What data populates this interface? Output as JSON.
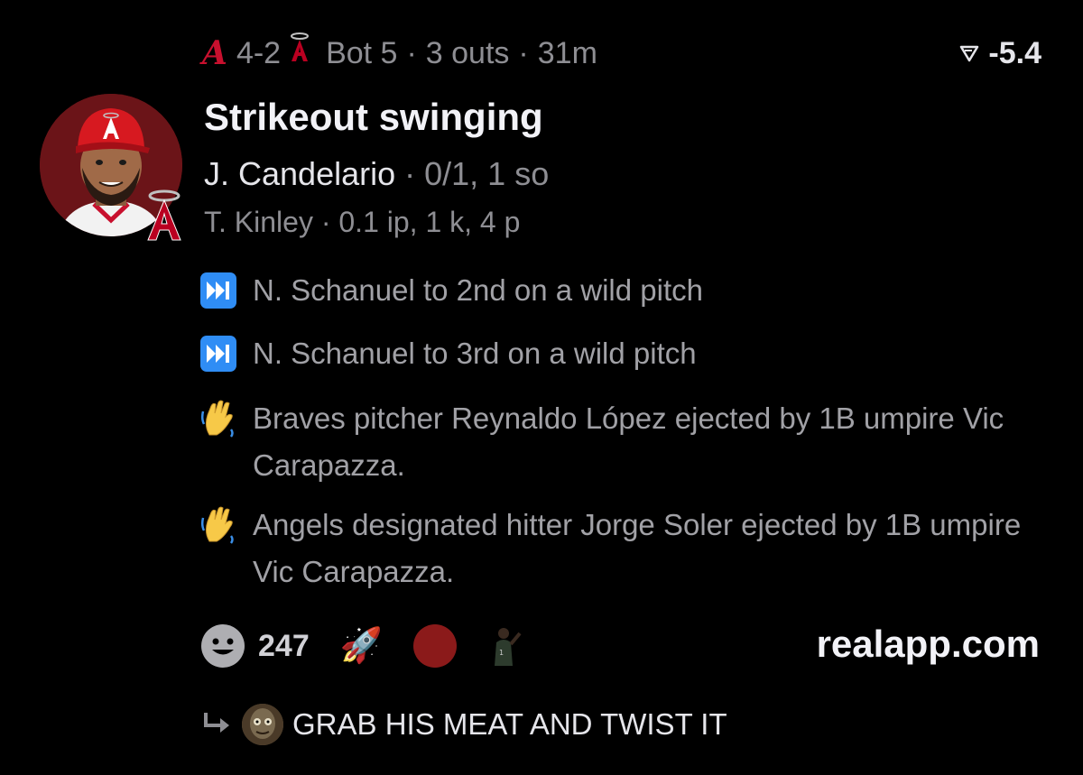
{
  "game": {
    "away_team_icon": "braves-logo-icon",
    "home_team_icon": "angels-logo-icon",
    "score": "4-2",
    "inning": "Bot 5",
    "outs": "3 outs",
    "elapsed": "31m",
    "sep": "·",
    "win_prob_icon": "win-probability-icon",
    "win_prob": "-5.4"
  },
  "play": {
    "title": "Strikeout swinging",
    "batter_name": "J. Candelario",
    "batter_stat": "· 0/1, 1 so",
    "pitcher_line": "T. Kinley · 0.1 ip, 1 k, 4 p"
  },
  "events": [
    {
      "icon": "fast-forward-icon",
      "text": "N. Schanuel to 2nd on a wild pitch"
    },
    {
      "icon": "fast-forward-icon",
      "text": "N. Schanuel to 3rd on a wild pitch"
    },
    {
      "icon": "waving-hand-icon",
      "text": "Braves pitcher Reynaldo López ejected by 1B umpire Vic Carapazza."
    },
    {
      "icon": "waving-hand-icon",
      "text": "Angels designated hitter Jorge Soler ejected by 1B umpire Vic Carapazza."
    }
  ],
  "reactions": {
    "count": "247",
    "rocket": "🚀",
    "colors": {
      "dot": "#8b1a1a"
    }
  },
  "brand": "realapp.com",
  "reply": {
    "text": "GRAB HIS MEAT AND TWIST IT"
  },
  "colors": {
    "background": "#000000",
    "muted": "#8e8e93",
    "braves_red": "#c8102e",
    "angels_red": "#ba0021",
    "ff_blue": "#2f8df5"
  }
}
